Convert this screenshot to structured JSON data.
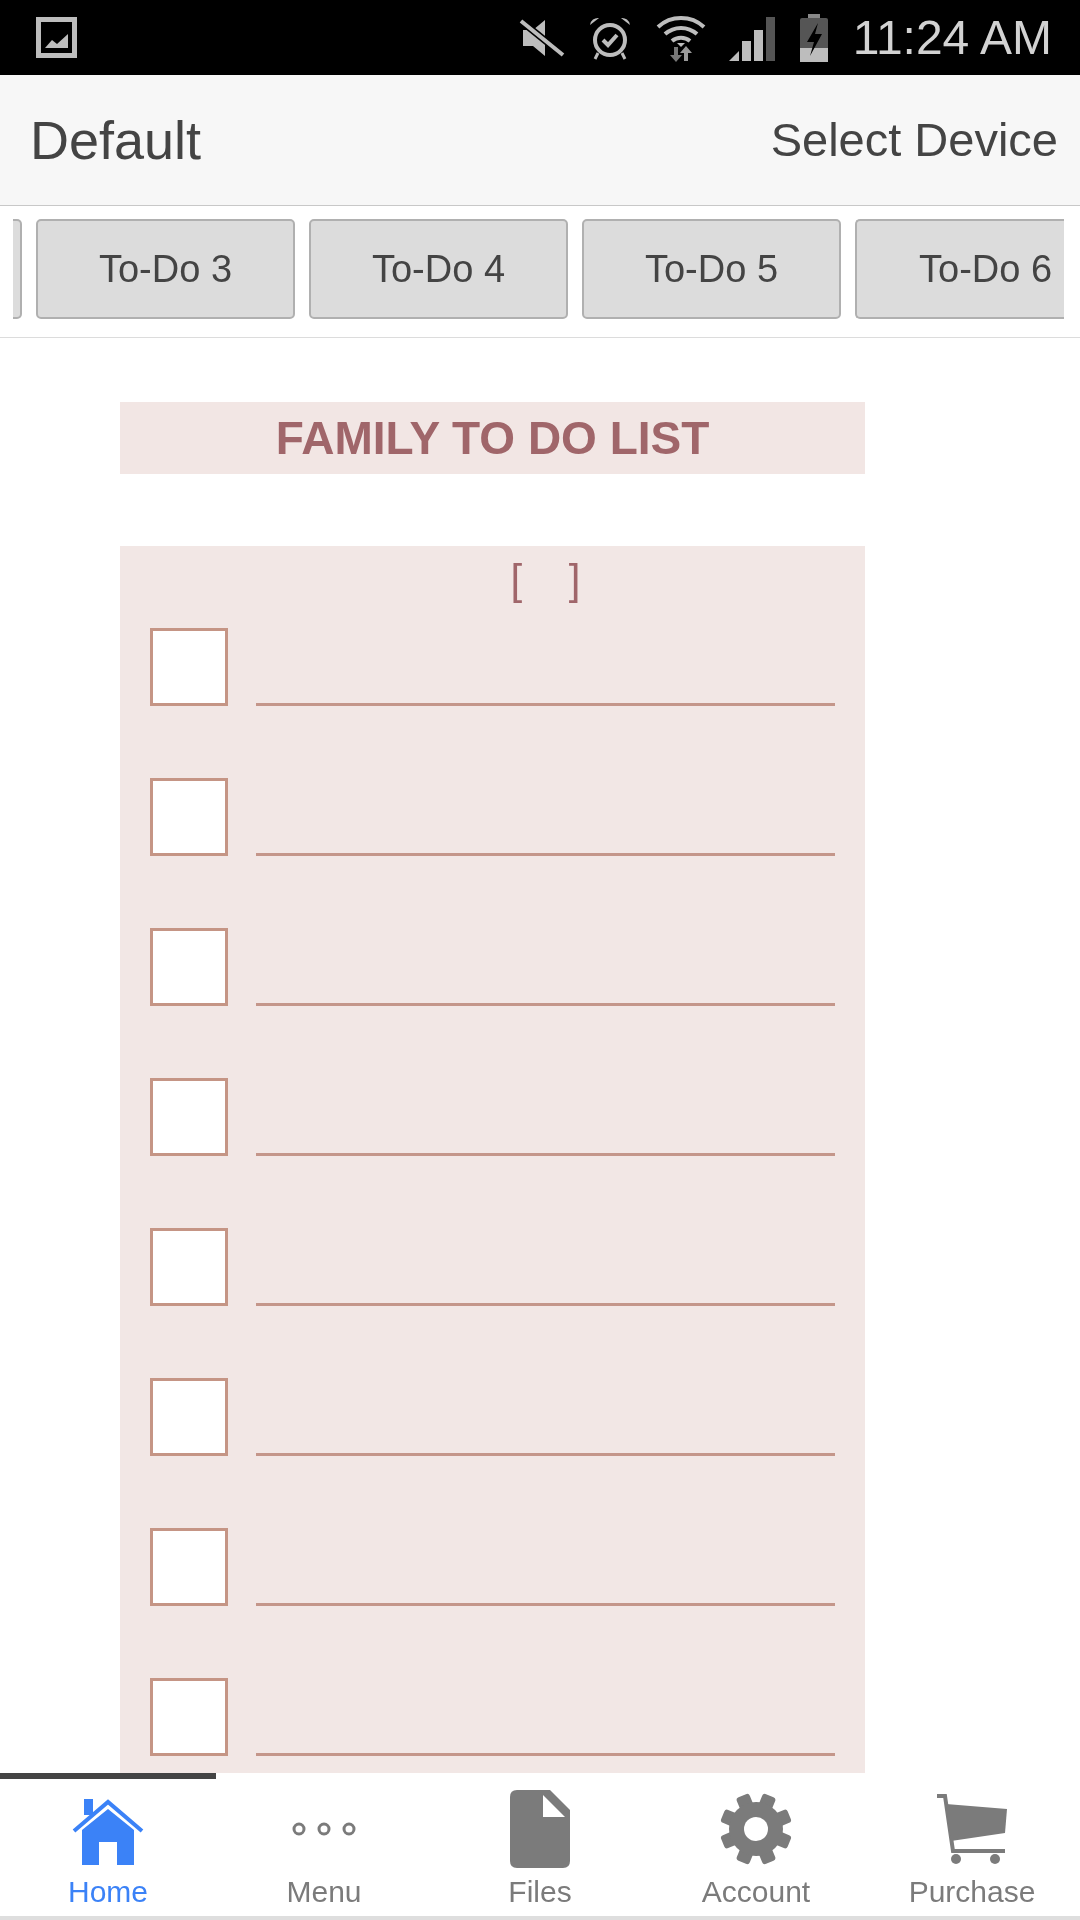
{
  "status_bar": {
    "time": "11:24 AM"
  },
  "header": {
    "title": "Default",
    "action": "Select Device"
  },
  "tabs": [
    {
      "selected": false
    },
    {
      "label": "To-Do 3",
      "selected": false
    },
    {
      "label": "To-Do 4",
      "selected": false
    },
    {
      "label": "To-Do 5",
      "selected": false
    },
    {
      "label": "To-Do 6",
      "selected": false
    }
  ],
  "list": {
    "title": "FAMILY TO DO LIST",
    "bracket": "[    ]",
    "items": [
      {
        "checked": false
      },
      {
        "checked": false
      },
      {
        "checked": false
      },
      {
        "checked": false
      },
      {
        "checked": false
      },
      {
        "checked": false
      },
      {
        "checked": false
      },
      {
        "checked": false
      }
    ]
  },
  "bottom_nav": [
    {
      "label": "Home",
      "selected": true
    },
    {
      "label": "Menu",
      "selected": false
    },
    {
      "label": "Files",
      "selected": false
    },
    {
      "label": "Account",
      "selected": false
    },
    {
      "label": "Purchase",
      "selected": false
    }
  ]
}
